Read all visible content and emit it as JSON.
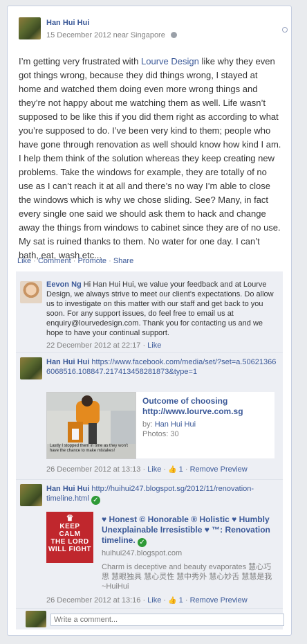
{
  "post": {
    "author": "Han Hui Hui",
    "meta": "15 December 2012 near Singapore",
    "text_before_link": "I’m getting very frustrated with ",
    "link_text": "Lourve Design",
    "text_after_link": " like why they even got things wrong, because they did things wrong, I stayed at home and watched them doing even more wrong things and they’re not happy about me watching them as well. Life wasn’t supposed to be like this if you did them right as according to what you’re supposed to do. I’ve been very kind to them; people who have gone through renovation as well should know how kind I am. I help them think of the solution whereas they keep creating new problems. Take the windows for example, they are totally of no use as I can’t reach it at all and there’s no way I’m able to close the windows which is why we chose sliding. See? Many, in fact every single one said we should ask them to hack and change away the things from windows to cabinet since they are of no use. My sat is ruined thanks to them. No water for one day. I can’t bath, eat, wash etc..."
  },
  "actions": {
    "like": "Like",
    "comment": "Comment",
    "promote": "Promote",
    "share": "Share",
    "sep": "·"
  },
  "comments": [
    {
      "author": "Eevon Ng",
      "text": "Hi Han Hui Hui, we value your feedback and at Lourve Design, we always strive to meet our client's expectations. Do allow us to investigate on this matter with our staff and get back to you soon. For any support issues, do feel free to email us at enquiry@lourvedesign.com. Thank you for contacting us and we hope to have your continual support.",
      "time": "22 December 2012 at 22:17",
      "like": "Like"
    },
    {
      "author": "Han Hui Hui",
      "text": "https://www.facebook.com/media/set/?set=a.506213666068516.108847.217413458281873&type=1",
      "share_title": "Outcome of choosing http://www.lourve.com.sg",
      "share_by_prefix": "by: ",
      "share_by": "Han Hui Hui",
      "share_photos": "Photos: 30",
      "photo_caption": "Lastly I stopped them in time as they won't have the chance to make mistakes!",
      "time": "26 December 2012 at 13:13",
      "like": "Like",
      "like_count": "1",
      "remove": "Remove Preview"
    },
    {
      "author": "Han Hui Hui",
      "text": "http://huihui247.blogspot.sg/2012/11/renovation-timeline.html",
      "share_title": "♥ Honest © Honorable ® Holistic ♥ Humbly Unexplainable Irresistible ♥ ™: Renovation timeline.",
      "share_domain": "huihui247.blogspot.com",
      "share_desc": "Charm is deceptive and beauty evaporates 慧心巧思 慧眼独具 慧心灵性 慧中秀外 慧心妙舌 慧慧是我 ~HuiHui",
      "poster_lines": [
        "KEEP",
        "CALM",
        "THE LORD",
        "WILL FIGHT"
      ],
      "time": "26 December 2012 at 13:16",
      "like": "Like",
      "like_count": "1",
      "remove": "Remove Preview"
    }
  ],
  "composer": {
    "placeholder": "Write a comment..."
  },
  "icons": {
    "globe": "globe-icon",
    "check": "verified-check-icon",
    "like": "thumbs-up-icon",
    "crown": "crown-icon"
  }
}
